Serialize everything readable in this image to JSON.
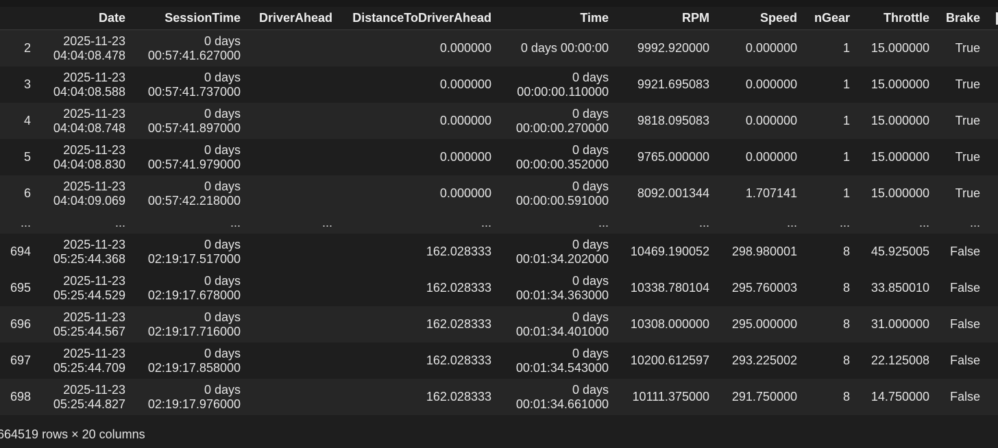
{
  "columns": [
    "",
    "Date",
    "SessionTime",
    "DriverAhead",
    "DistanceToDriverAhead",
    "Time",
    "RPM",
    "Speed",
    "nGear",
    "Throttle",
    "Brake"
  ],
  "rows": [
    {
      "index": "2",
      "date": [
        "2025-11-23",
        "04:04:08.478"
      ],
      "session_time": [
        "0 days",
        "00:57:41.627000"
      ],
      "driver_ahead": "",
      "distance": "0.000000",
      "time": [
        "0 days 00:00:00"
      ],
      "rpm": "9992.920000",
      "speed": "0.000000",
      "ngear": "1",
      "throttle": "15.000000",
      "brake": "True"
    },
    {
      "index": "3",
      "date": [
        "2025-11-23",
        "04:04:08.588"
      ],
      "session_time": [
        "0 days",
        "00:57:41.737000"
      ],
      "driver_ahead": "",
      "distance": "0.000000",
      "time": [
        "0 days",
        "00:00:00.110000"
      ],
      "rpm": "9921.695083",
      "speed": "0.000000",
      "ngear": "1",
      "throttle": "15.000000",
      "brake": "True"
    },
    {
      "index": "4",
      "date": [
        "2025-11-23",
        "04:04:08.748"
      ],
      "session_time": [
        "0 days",
        "00:57:41.897000"
      ],
      "driver_ahead": "",
      "distance": "0.000000",
      "time": [
        "0 days",
        "00:00:00.270000"
      ],
      "rpm": "9818.095083",
      "speed": "0.000000",
      "ngear": "1",
      "throttle": "15.000000",
      "brake": "True"
    },
    {
      "index": "5",
      "date": [
        "2025-11-23",
        "04:04:08.830"
      ],
      "session_time": [
        "0 days",
        "00:57:41.979000"
      ],
      "driver_ahead": "",
      "distance": "0.000000",
      "time": [
        "0 days",
        "00:00:00.352000"
      ],
      "rpm": "9765.000000",
      "speed": "0.000000",
      "ngear": "1",
      "throttle": "15.000000",
      "brake": "True"
    },
    {
      "index": "6",
      "date": [
        "2025-11-23",
        "04:04:09.069"
      ],
      "session_time": [
        "0 days",
        "00:57:42.218000"
      ],
      "driver_ahead": "",
      "distance": "0.000000",
      "time": [
        "0 days",
        "00:00:00.591000"
      ],
      "rpm": "8092.001344",
      "speed": "1.707141",
      "ngear": "1",
      "throttle": "15.000000",
      "brake": "True"
    },
    {
      "ellipsis": true,
      "index": "...",
      "date": [
        "..."
      ],
      "session_time": [
        "..."
      ],
      "driver_ahead": "...",
      "distance": "...",
      "time": [
        "..."
      ],
      "rpm": "...",
      "speed": "...",
      "ngear": "...",
      "throttle": "...",
      "brake": "..."
    },
    {
      "index": "694",
      "date": [
        "2025-11-23",
        "05:25:44.368"
      ],
      "session_time": [
        "0 days",
        "02:19:17.517000"
      ],
      "driver_ahead": "",
      "distance": "162.028333",
      "time": [
        "0 days",
        "00:01:34.202000"
      ],
      "rpm": "10469.190052",
      "speed": "298.980001",
      "ngear": "8",
      "throttle": "45.925005",
      "brake": "False"
    },
    {
      "index": "695",
      "date": [
        "2025-11-23",
        "05:25:44.529"
      ],
      "session_time": [
        "0 days",
        "02:19:17.678000"
      ],
      "driver_ahead": "",
      "distance": "162.028333",
      "time": [
        "0 days",
        "00:01:34.363000"
      ],
      "rpm": "10338.780104",
      "speed": "295.760003",
      "ngear": "8",
      "throttle": "33.850010",
      "brake": "False"
    },
    {
      "index": "696",
      "date": [
        "2025-11-23",
        "05:25:44.567"
      ],
      "session_time": [
        "0 days",
        "02:19:17.716000"
      ],
      "driver_ahead": "",
      "distance": "162.028333",
      "time": [
        "0 days",
        "00:01:34.401000"
      ],
      "rpm": "10308.000000",
      "speed": "295.000000",
      "ngear": "8",
      "throttle": "31.000000",
      "brake": "False"
    },
    {
      "index": "697",
      "date": [
        "2025-11-23",
        "05:25:44.709"
      ],
      "session_time": [
        "0 days",
        "02:19:17.858000"
      ],
      "driver_ahead": "",
      "distance": "162.028333",
      "time": [
        "0 days",
        "00:01:34.543000"
      ],
      "rpm": "10200.612597",
      "speed": "293.225002",
      "ngear": "8",
      "throttle": "22.125008",
      "brake": "False"
    },
    {
      "index": "698",
      "date": [
        "2025-11-23",
        "05:25:44.827"
      ],
      "session_time": [
        "0 days",
        "02:19:17.976000"
      ],
      "driver_ahead": "",
      "distance": "162.028333",
      "time": [
        "0 days",
        "00:01:34.661000"
      ],
      "rpm": "10111.375000",
      "speed": "291.750000",
      "ngear": "8",
      "throttle": "14.750000",
      "brake": "False"
    }
  ],
  "footer": "664519 rows × 20 columns"
}
